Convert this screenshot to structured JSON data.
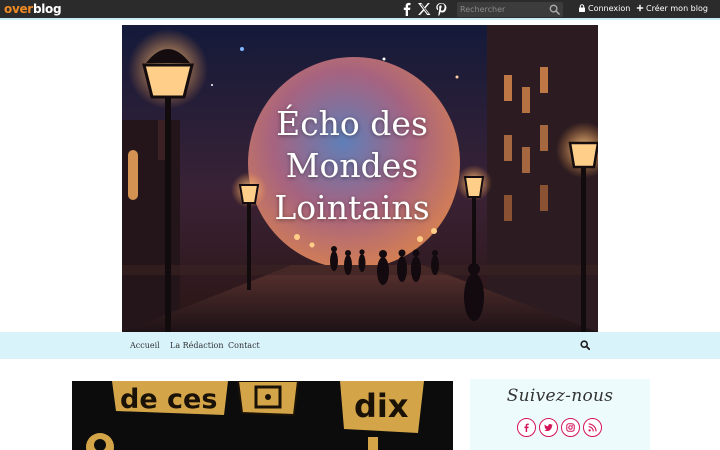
{
  "topbar": {
    "logo_part1": "over",
    "logo_part2": "blog",
    "search_placeholder": "Rechercher",
    "login_label": "Connexion",
    "create_label": "Créer mon blog"
  },
  "header": {
    "title_line1": "Écho des",
    "title_line2": "Mondes",
    "title_line3": "Lointains"
  },
  "nav": {
    "items": [
      {
        "label": "Accueil"
      },
      {
        "label": "La Rédaction"
      },
      {
        "label": "Contact"
      }
    ]
  },
  "article": {
    "image_text_left": "de ces",
    "image_text_right": "dix"
  },
  "sidebar": {
    "follow_title": "Suivez-nous",
    "social_buttons": [
      "facebook-icon",
      "twitter-icon",
      "instagram-icon",
      "rss-icon"
    ]
  },
  "colors": {
    "topbar_bg": "#2b2b2b",
    "logo_accent": "#f08a24",
    "nav_bg": "#d9f3fb",
    "social_accent": "#d4145a"
  }
}
